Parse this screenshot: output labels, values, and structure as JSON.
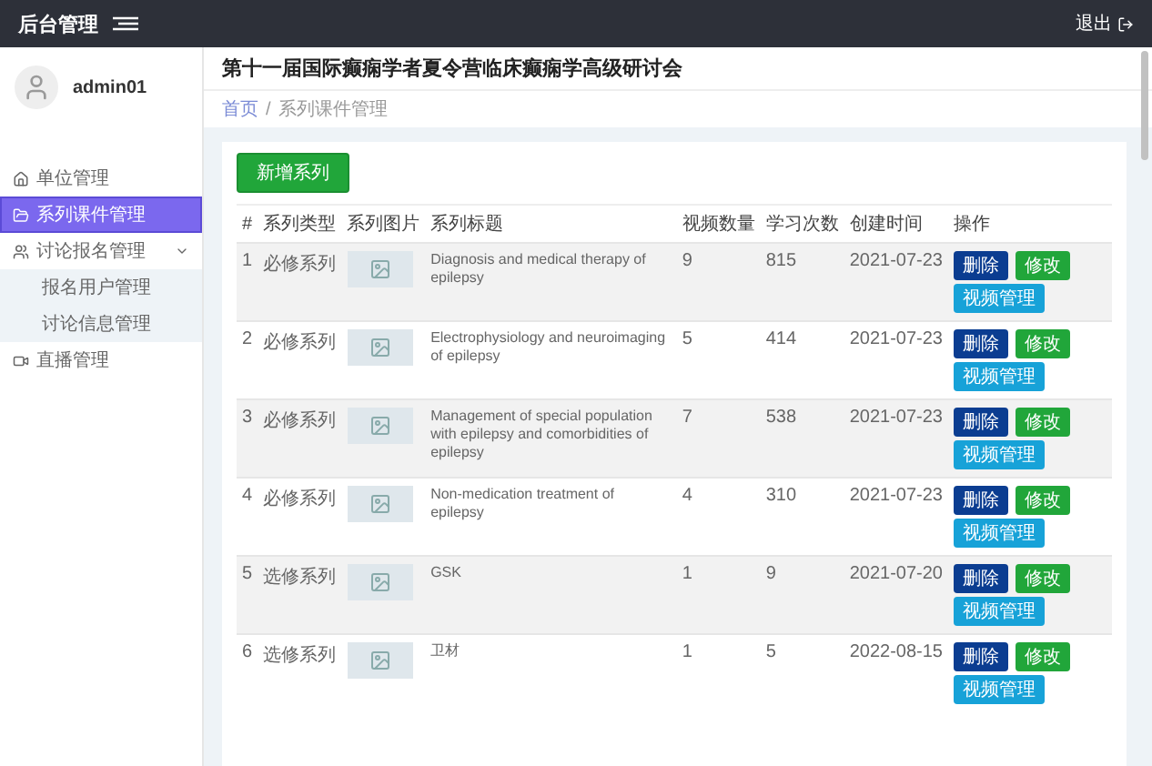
{
  "topbar": {
    "brand": "后台管理",
    "logout": "退出"
  },
  "user": {
    "name": "admin01"
  },
  "sidebar": {
    "items": [
      {
        "label": "单位管理",
        "selected": false
      },
      {
        "label": "系列课件管理",
        "selected": true
      },
      {
        "label": "讨论报名管理",
        "selected": false,
        "expanded": true,
        "children": [
          {
            "label": "报名用户管理",
            "selected": false
          },
          {
            "label": "讨论信息管理",
            "selected": false
          }
        ]
      },
      {
        "label": "直播管理",
        "selected": false
      }
    ]
  },
  "page_title": "第十一届国际癫痫学者夏令营临床癫痫学高级研讨会",
  "breadcrumb": [
    "首页",
    "系列课件管理"
  ],
  "breadcrumb_separator": "/",
  "add_button": "新增系列",
  "table": {
    "columns": [
      "#",
      "系列类型",
      "系列图片",
      "系列标题",
      "视频数量",
      "学习次数",
      "创建时间",
      "操作"
    ],
    "rows": [
      {
        "index": "1",
        "type": "必修系列",
        "title": "Diagnosis and medical therapy of epilepsy",
        "videos": "9",
        "views": "815",
        "created": "2021-07-23",
        "actions": [
          "删除",
          "修改",
          "视频管理"
        ]
      },
      {
        "index": "2",
        "type": "必修系列",
        "title": "Electrophysiology and neuroimaging of epilepsy",
        "videos": "5",
        "views": "414",
        "created": "2021-07-23",
        "actions": [
          "删除",
          "修改",
          "视频管理"
        ]
      },
      {
        "index": "3",
        "type": "必修系列",
        "title": "Management of special population with epilepsy and comorbidities of epilepsy",
        "videos": "7",
        "views": "538",
        "created": "2021-07-23",
        "actions": [
          "删除",
          "修改",
          "视频管理"
        ]
      },
      {
        "index": "4",
        "type": "必修系列",
        "title": "Non-medication treatment of epilepsy",
        "videos": "4",
        "views": "310",
        "created": "2021-07-23",
        "actions": [
          "删除",
          "修改",
          "视频管理"
        ]
      },
      {
        "index": "5",
        "type": "选修系列",
        "title": "GSK",
        "videos": "1",
        "views": "9",
        "created": "2021-07-20",
        "actions": [
          "删除",
          "修改",
          "视频管理"
        ]
      },
      {
        "index": "6",
        "type": "选修系列",
        "title": "卫材",
        "videos": "1",
        "views": "5",
        "created": "2022-08-15",
        "actions": [
          "删除",
          "修改",
          "视频管理"
        ]
      }
    ]
  }
}
